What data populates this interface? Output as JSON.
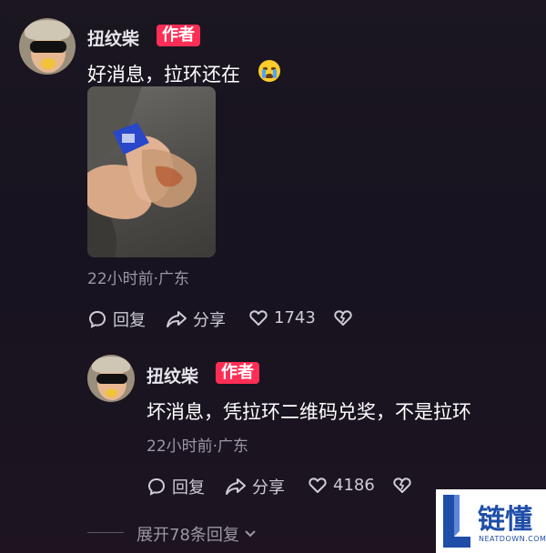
{
  "comment": {
    "author": "扭纹柴",
    "badge": "作者",
    "text": "好消息，拉环还在",
    "meta": "22小时前·广东",
    "reply_label": "回复",
    "share_label": "分享",
    "likes": "1743"
  },
  "reply": {
    "author": "扭纹柴",
    "badge": "作者",
    "text": "坏消息，凭拉环二维码兑奖，不是拉环",
    "meta": "22小时前·广东",
    "reply_label": "回复",
    "share_label": "分享",
    "likes": "4186"
  },
  "expand_label": "展开78条回复",
  "watermark": {
    "text": "链懂",
    "sub": "NEATDOWN.COM"
  },
  "colors": {
    "badge": "#ff2e55",
    "background": "#1b1620",
    "meta": "#9b97a4"
  }
}
